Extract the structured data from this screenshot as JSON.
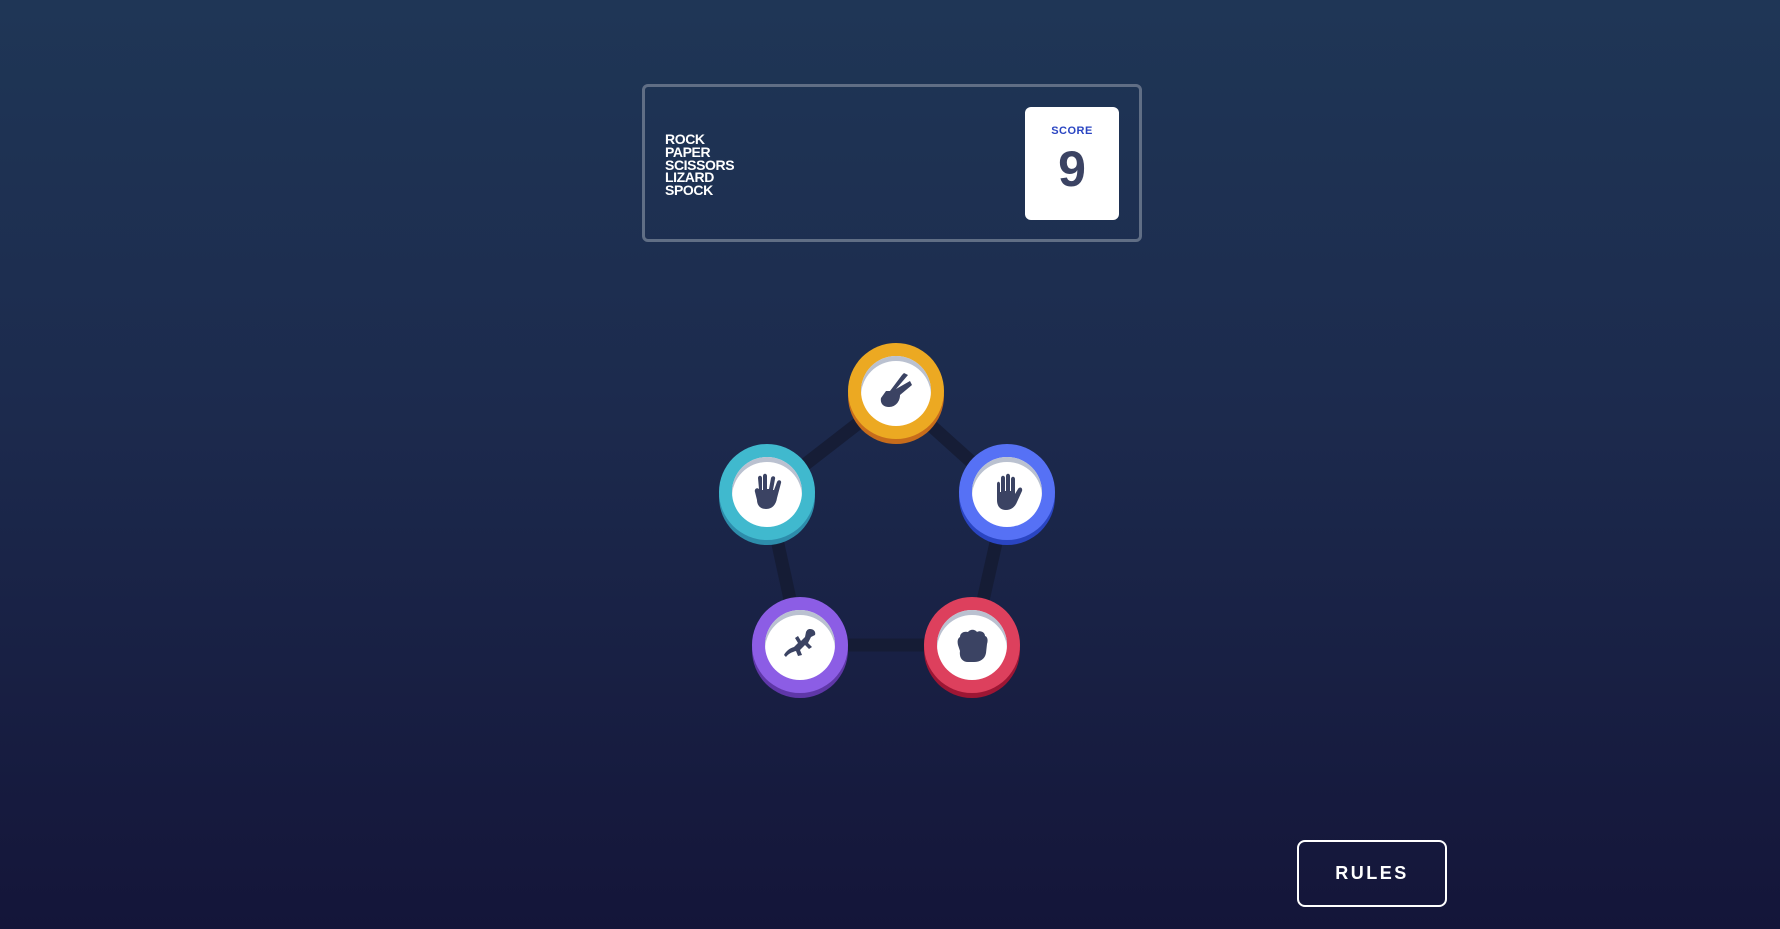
{
  "header": {
    "title_lines": [
      "Rock",
      "Paper",
      "Scissors",
      "Lizard",
      "Spock"
    ],
    "score_label": "Score",
    "score_value": "9"
  },
  "tokens": [
    {
      "name": "scissors",
      "icon": "scissors-hand-icon",
      "color": "#eca922",
      "shadow": "#c76c1b"
    },
    {
      "name": "paper",
      "icon": "paper-hand-icon",
      "color": "#5671f5",
      "shadow": "#2a45c2"
    },
    {
      "name": "rock",
      "icon": "rock-fist-icon",
      "color": "#dd405d",
      "shadow": "#9d1634"
    },
    {
      "name": "lizard",
      "icon": "lizard-icon",
      "color": "#8c5de5",
      "shadow": "#5f37a8"
    },
    {
      "name": "spock",
      "icon": "spock-hand-icon",
      "color": "#40b9ce",
      "shadow": "#2d8dab"
    }
  ],
  "rules_button": {
    "label": "RULES"
  },
  "colors": {
    "background_top": "#1f3656",
    "background_bottom": "#141539",
    "header_border": "#606e85",
    "score_label": "#2a45c2",
    "score_value": "#3b4363",
    "pentagon_line": "#151b33",
    "icon_fill": "#3b4363"
  }
}
